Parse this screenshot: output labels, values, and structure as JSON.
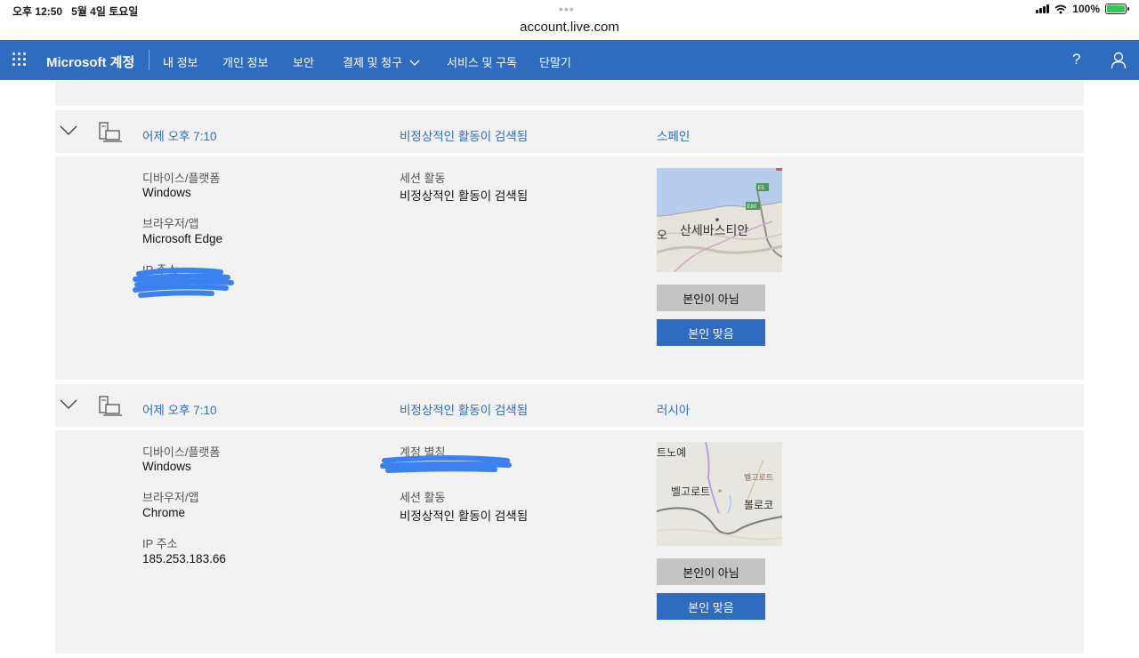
{
  "status": {
    "time": "오후 12:50",
    "date": "5월 4일 토요일",
    "url": "account.live.com",
    "battery": "100%"
  },
  "nav": {
    "brand": "Microsoft 계정",
    "items": [
      "내 정보",
      "개인 정보",
      "보안",
      "결제 및 청구",
      "서비스 및 구독",
      "단말기"
    ],
    "help": "?"
  },
  "activities": [
    {
      "time": "어제 오후 7:10",
      "status": "비정상적인 활동이 검색됨",
      "location": "스페인",
      "device_label": "디바이스/플랫폼",
      "device": "Windows",
      "browser_label": "브라우저/앱",
      "browser": "Microsoft Edge",
      "ip_label": "IP 주소",
      "session_label": "세션 활동",
      "session": "비정상적인 활동이 검색됨",
      "map_labels": [
        "산세바스티안",
        "E5",
        "E80",
        "오"
      ],
      "btn_not_me": "본인이 아님",
      "btn_me": "본인 맞음"
    },
    {
      "time": "어제 오후 7:10",
      "status": "비정상적인 활동이 검색됨",
      "location": "러시아",
      "device_label": "디바이스/플랫폼",
      "device": "Windows",
      "browser_label": "브라우저/앱",
      "browser": "Chrome",
      "ip_label": "IP 주소",
      "ip": "185.253.183.66",
      "alias_label": "계정 별칭",
      "session_label": "세션 활동",
      "session": "비정상적인 활동이 검색됨",
      "map_labels": [
        "트노예",
        "벨고로트",
        "벨고로트",
        "볼로코"
      ],
      "btn_not_me": "본인이 아님",
      "btn_me": "본인 맞음"
    }
  ],
  "colors": {
    "nav_bg": "#2f6bbf",
    "card_bg": "#f2f2f2",
    "link": "#2f6bbf",
    "redaction": "#3b82f0"
  }
}
